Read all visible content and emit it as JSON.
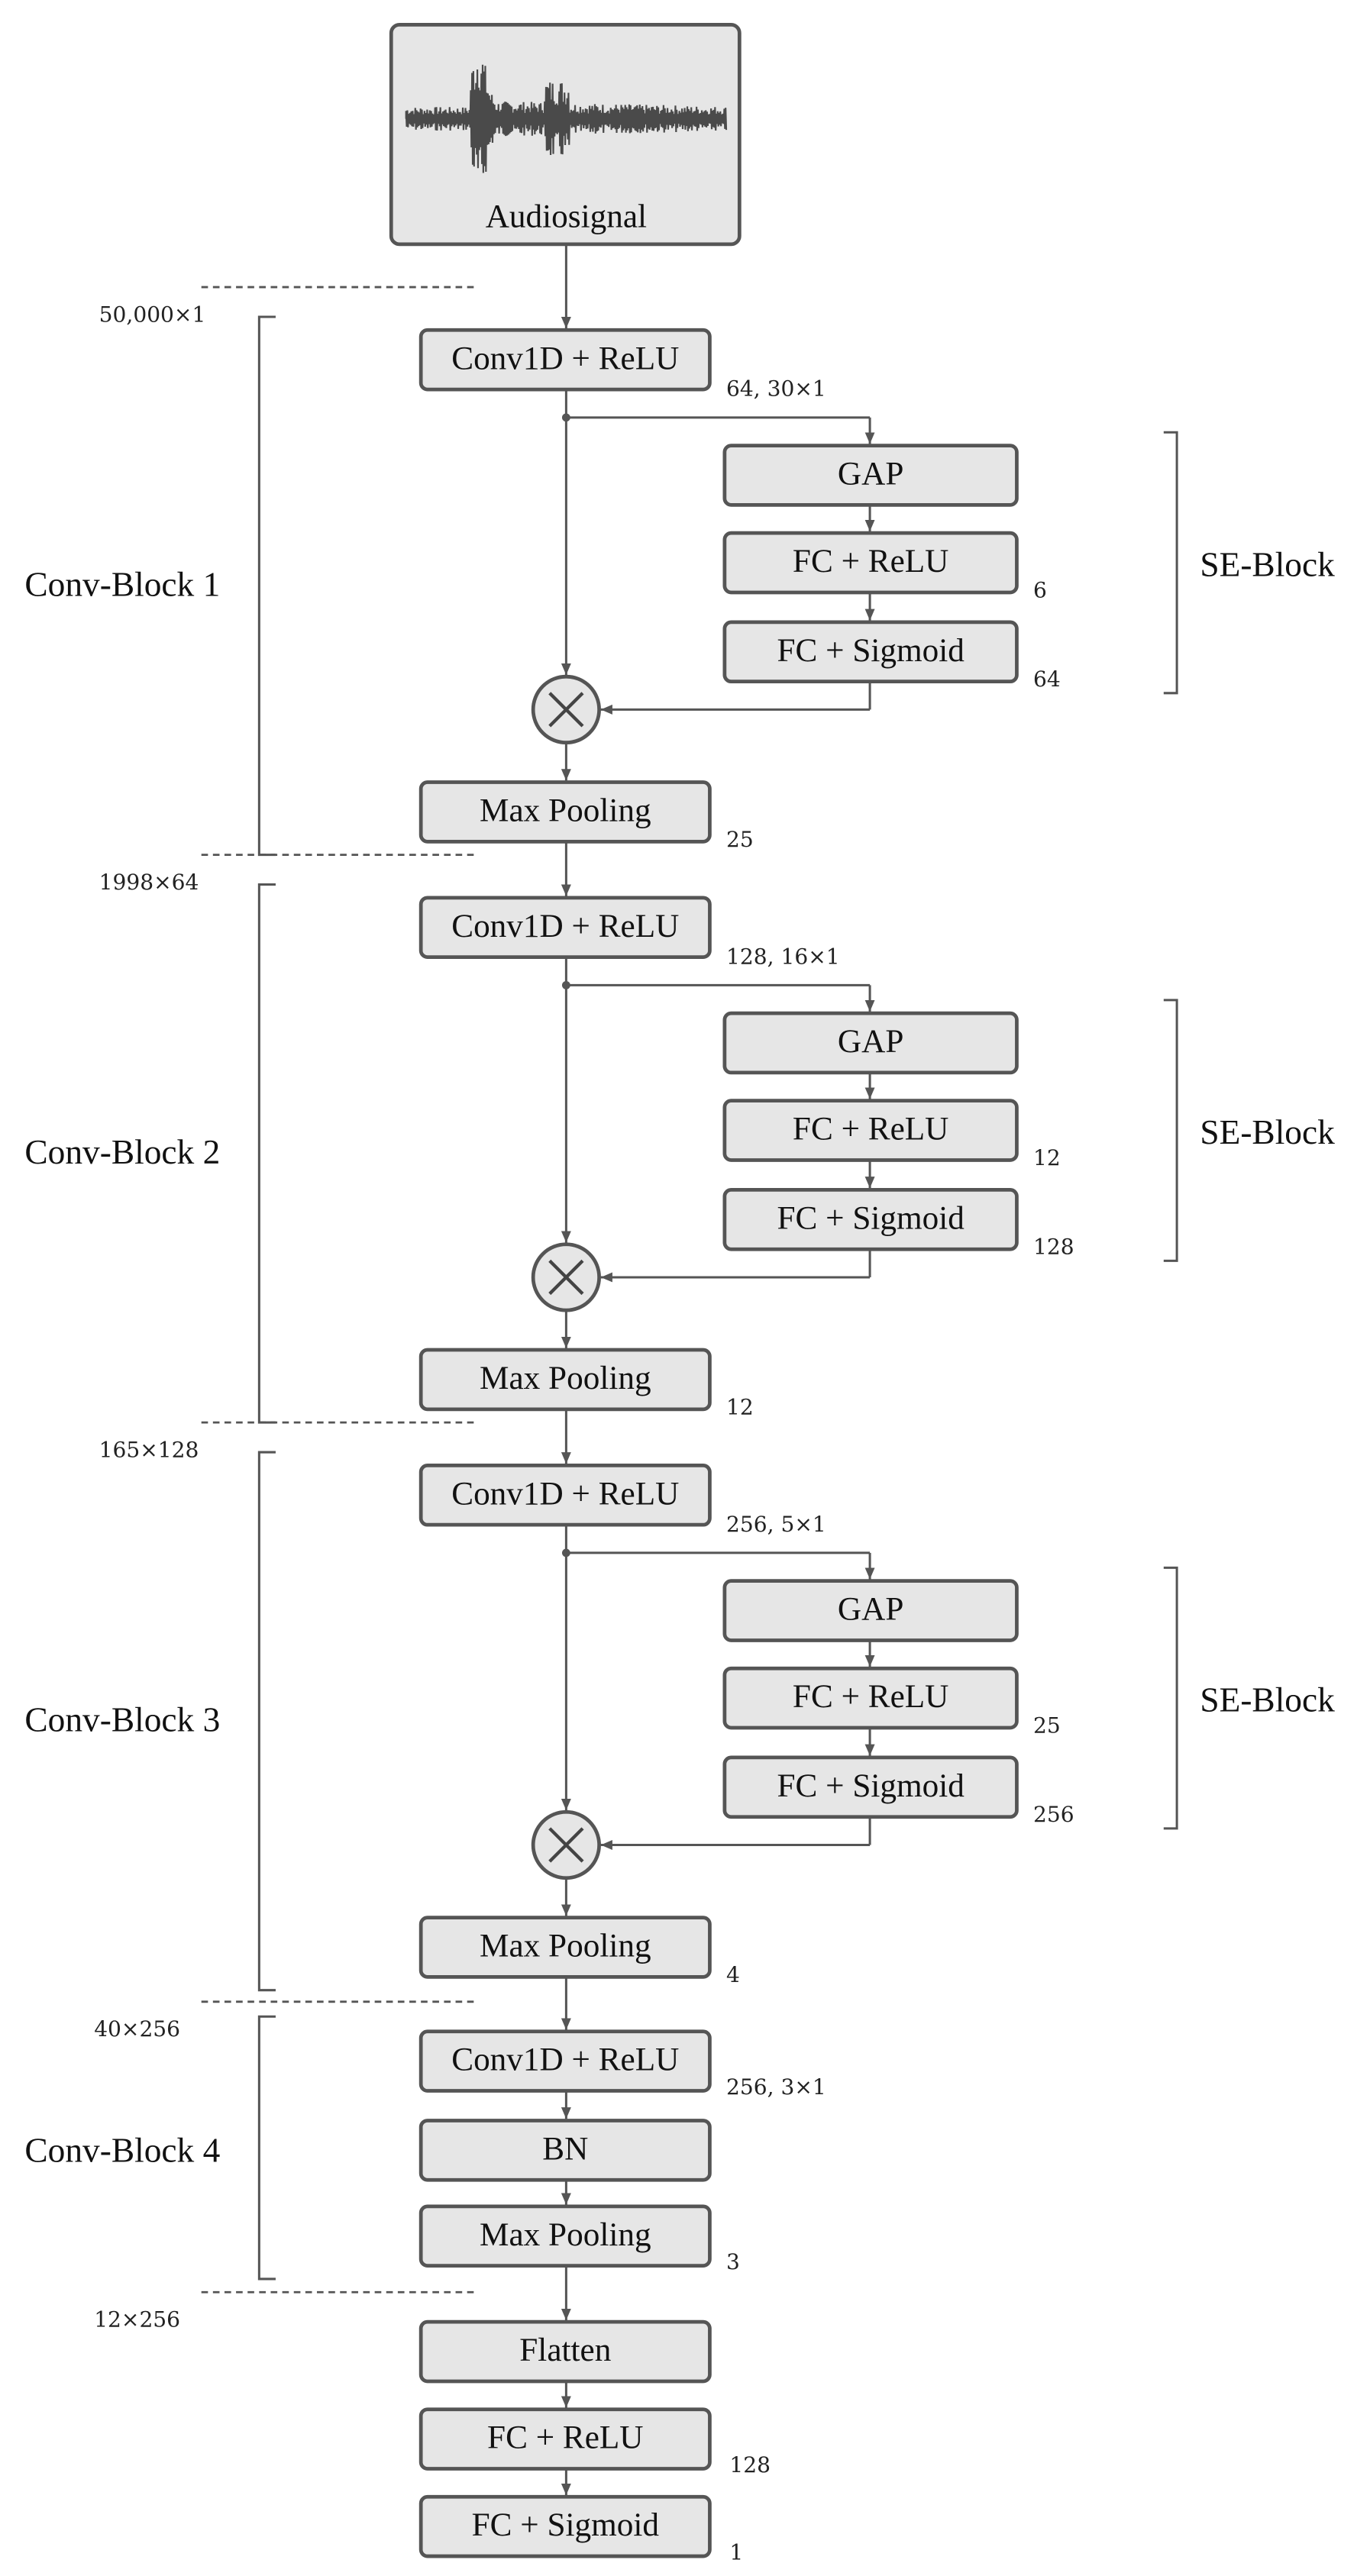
{
  "input": {
    "label": "Audiosignal"
  },
  "conv_blocks": [
    {
      "label": "Conv-Block 1",
      "input_shape": "50,000×1",
      "conv": {
        "label": "Conv1D + ReLU",
        "params": "64, 30×1"
      },
      "se_block": {
        "label": "SE-Block",
        "layers": [
          {
            "label": "GAP"
          },
          {
            "label": "FC + ReLU",
            "params": "6"
          },
          {
            "label": "FC + Sigmoid",
            "params": "64"
          }
        ]
      },
      "pool": {
        "label": "Max Pooling",
        "params": "25"
      }
    },
    {
      "label": "Conv-Block 2",
      "input_shape": "1998×64",
      "conv": {
        "label": "Conv1D + ReLU",
        "params": "128, 16×1"
      },
      "se_block": {
        "label": "SE-Block",
        "layers": [
          {
            "label": "GAP"
          },
          {
            "label": "FC + ReLU",
            "params": "12"
          },
          {
            "label": "FC + Sigmoid",
            "params": "128"
          }
        ]
      },
      "pool": {
        "label": "Max Pooling",
        "params": "12"
      }
    },
    {
      "label": "Conv-Block 3",
      "input_shape": "165×128",
      "conv": {
        "label": "Conv1D + ReLU",
        "params": "256, 5×1"
      },
      "se_block": {
        "label": "SE-Block",
        "layers": [
          {
            "label": "GAP"
          },
          {
            "label": "FC + ReLU",
            "params": "25"
          },
          {
            "label": "FC + Sigmoid",
            "params": "256"
          }
        ]
      },
      "pool": {
        "label": "Max Pooling",
        "params": "4"
      }
    }
  ],
  "conv_block_4": {
    "label": "Conv-Block 4",
    "input_shape": "40×256",
    "layers": [
      {
        "label": "Conv1D + ReLU",
        "params": "256, 3×1"
      },
      {
        "label": "BN"
      },
      {
        "label": "Max Pooling",
        "params": "3"
      }
    ]
  },
  "output_shape": "12×256",
  "head": [
    {
      "label": "Flatten"
    },
    {
      "label": "FC + ReLU",
      "params": "128"
    },
    {
      "label": "FC + Sigmoid",
      "params": "1"
    }
  ],
  "colors": {
    "box_fill": "#e6e6e6",
    "stroke": "#555555",
    "waveform": "#4a4a4a"
  }
}
